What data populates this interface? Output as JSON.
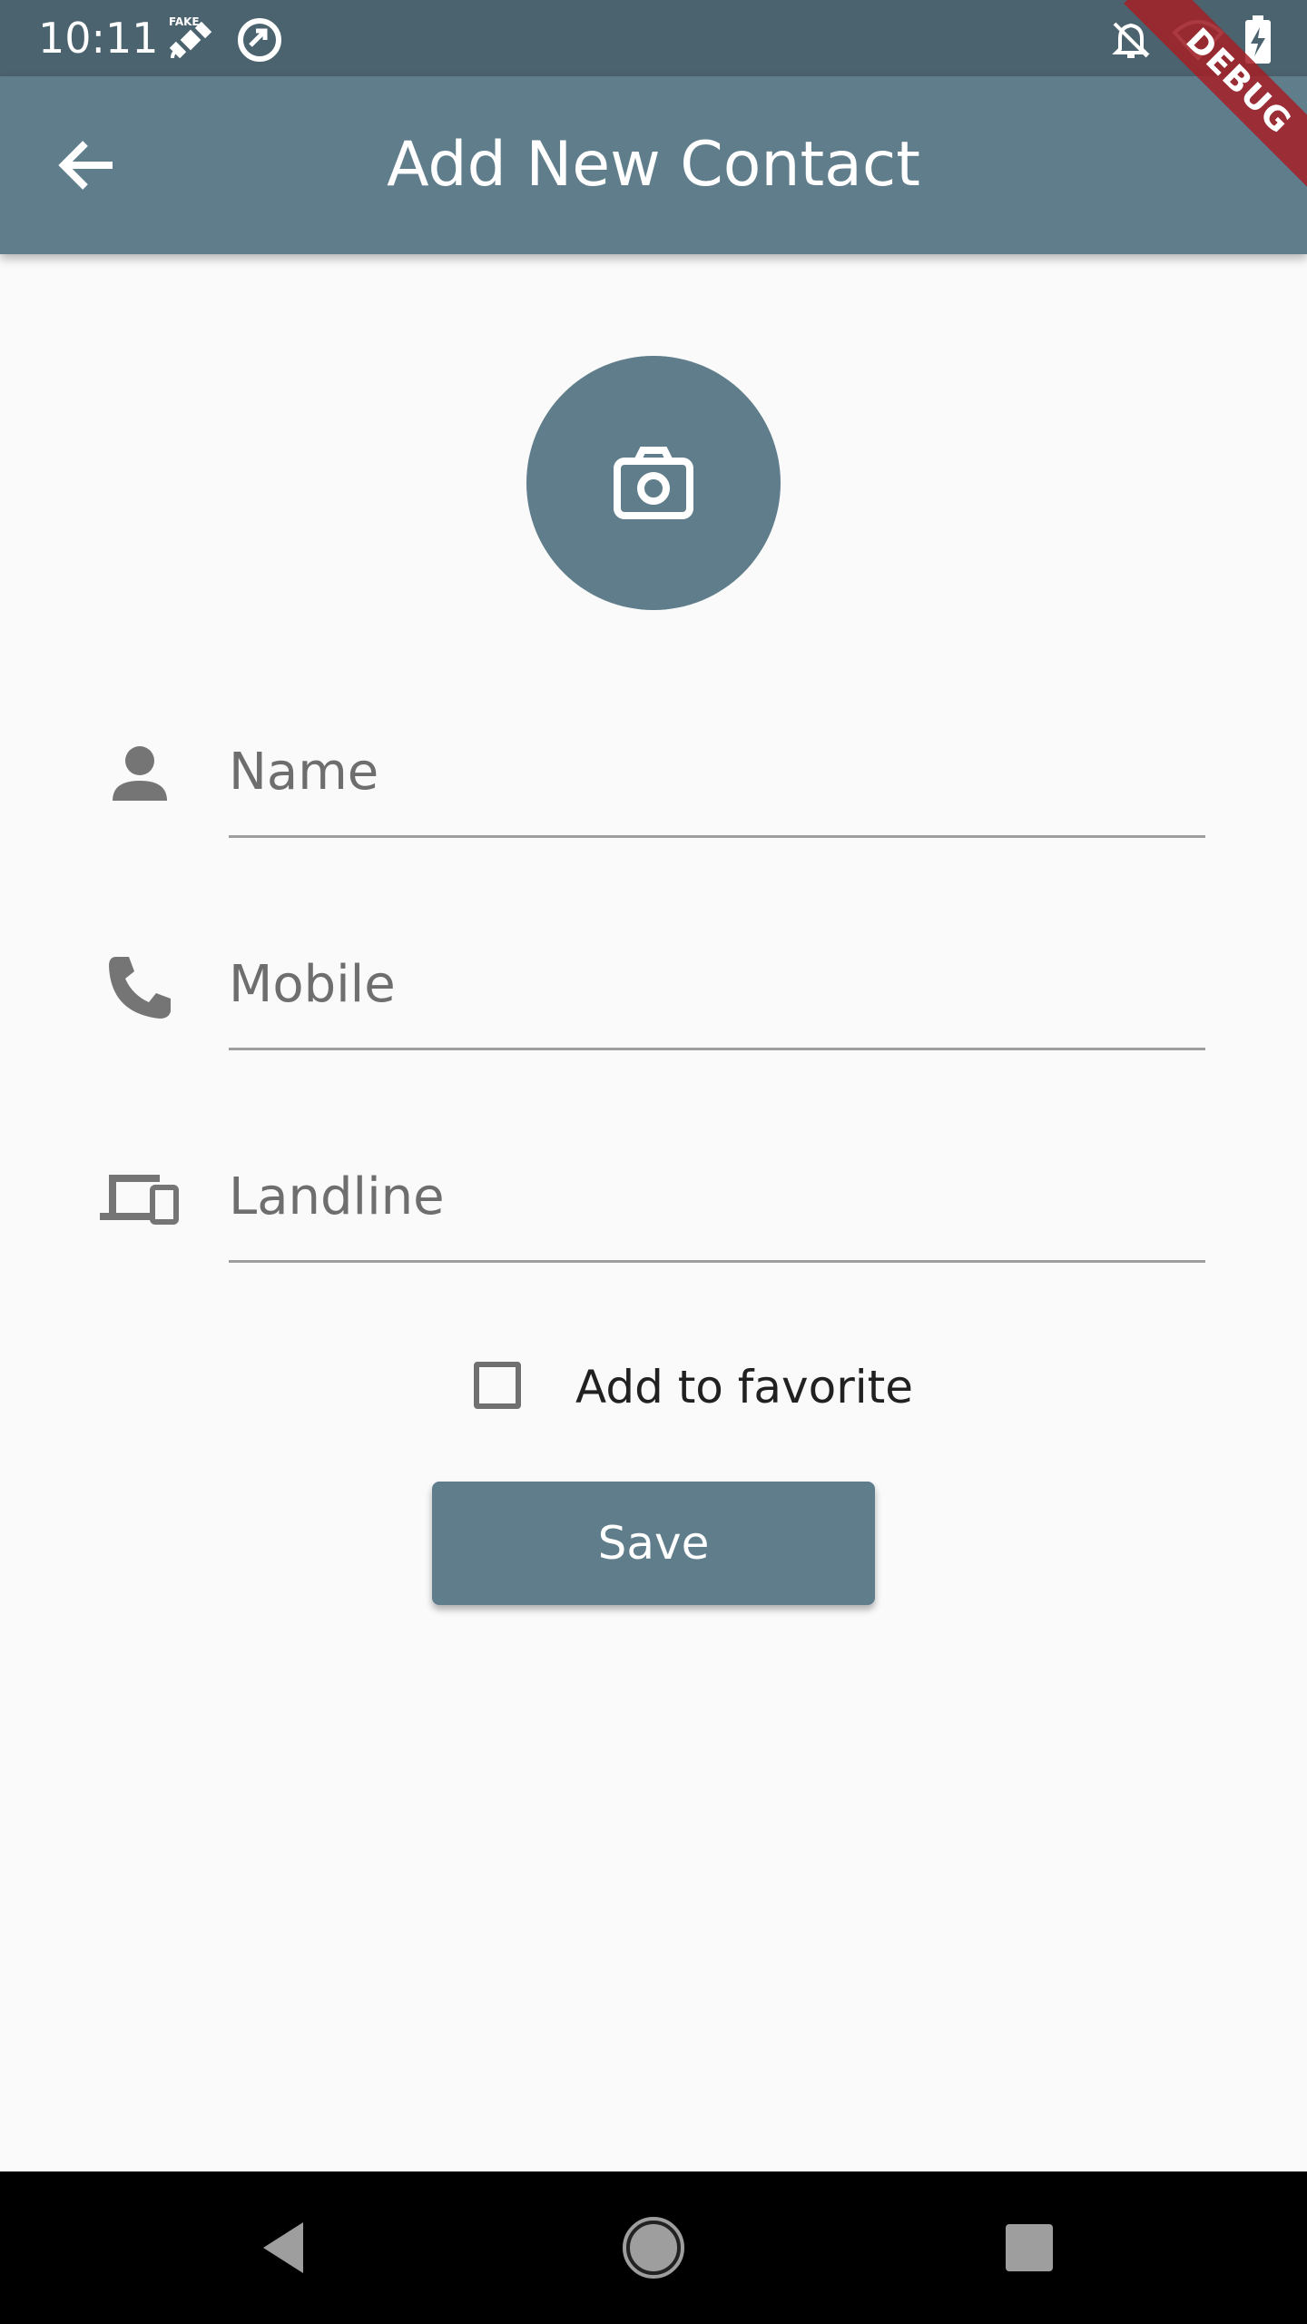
{
  "status_bar": {
    "time": "10:11",
    "icons": [
      "fake-gps-icon",
      "data-saver-icon",
      "notifications-off-icon",
      "wifi-icon",
      "battery-charging-icon"
    ]
  },
  "debug_banner": {
    "label": "DEBUG"
  },
  "app_bar": {
    "title": "Add New Contact",
    "back_icon": "arrow-back-icon"
  },
  "avatar": {
    "icon": "camera-icon"
  },
  "form": {
    "name": {
      "placeholder": "Name",
      "value": "",
      "icon": "person-icon"
    },
    "mobile": {
      "placeholder": "Mobile",
      "value": "",
      "icon": "phone-icon"
    },
    "landline": {
      "placeholder": "Landline",
      "value": "",
      "icon": "devices-icon"
    },
    "favorite": {
      "label": "Add to favorite",
      "checked": false
    },
    "save_label": "Save"
  },
  "colors": {
    "primary": "#607d8b",
    "status_bar": "#4b636f",
    "background": "#fafafa",
    "debug": "#a51e26"
  },
  "nav_bar": {
    "buttons": [
      "back-triangle-icon",
      "home-circle-icon",
      "recents-square-icon"
    ]
  }
}
